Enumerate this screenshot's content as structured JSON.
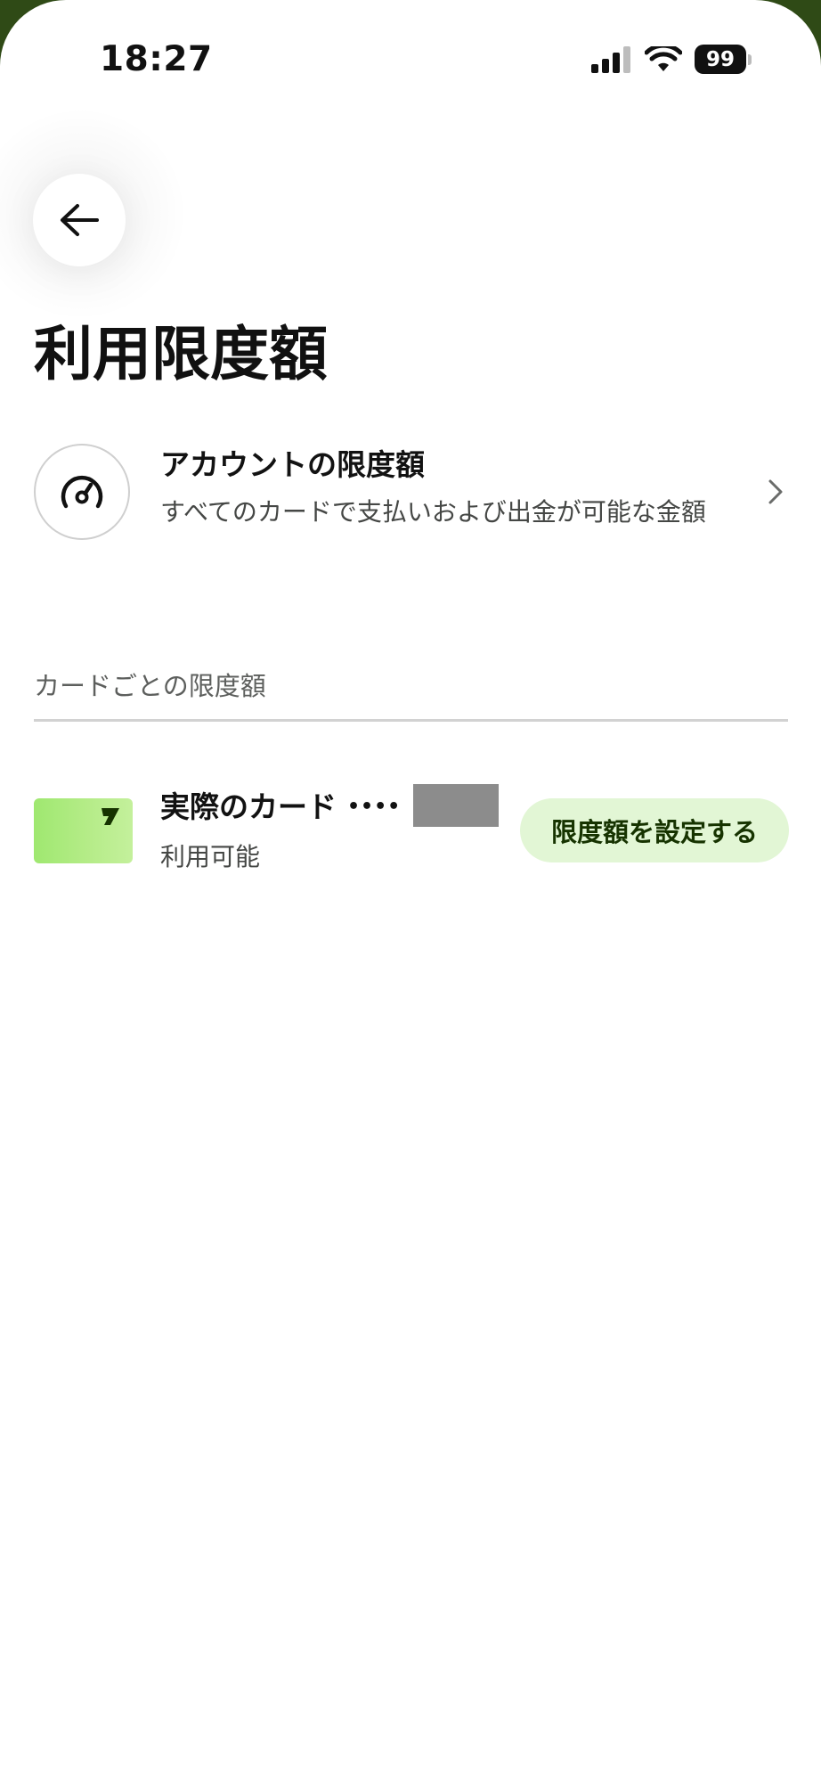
{
  "status_bar": {
    "time": "18:27",
    "battery": "99"
  },
  "header": {
    "title": "利用限度額"
  },
  "account_limit": {
    "title": "アカウントの限度額",
    "description": "すべてのカードで支払いおよび出金が可能な金額"
  },
  "card_section": {
    "header": "カードごとの限度額",
    "cards": [
      {
        "name": "実際のカード",
        "masked_number": "••••",
        "status": "利用可能",
        "action_label": "限度額を設定する"
      }
    ]
  },
  "colors": {
    "accent_green": "#9fe870",
    "button_bg": "#e2f6d5",
    "button_text": "#163300"
  },
  "icons": [
    "back-arrow-icon",
    "speedometer-icon",
    "chevron-right-icon",
    "wise-logo-icon",
    "cellular-signal-icon",
    "wifi-icon",
    "battery-icon"
  ]
}
